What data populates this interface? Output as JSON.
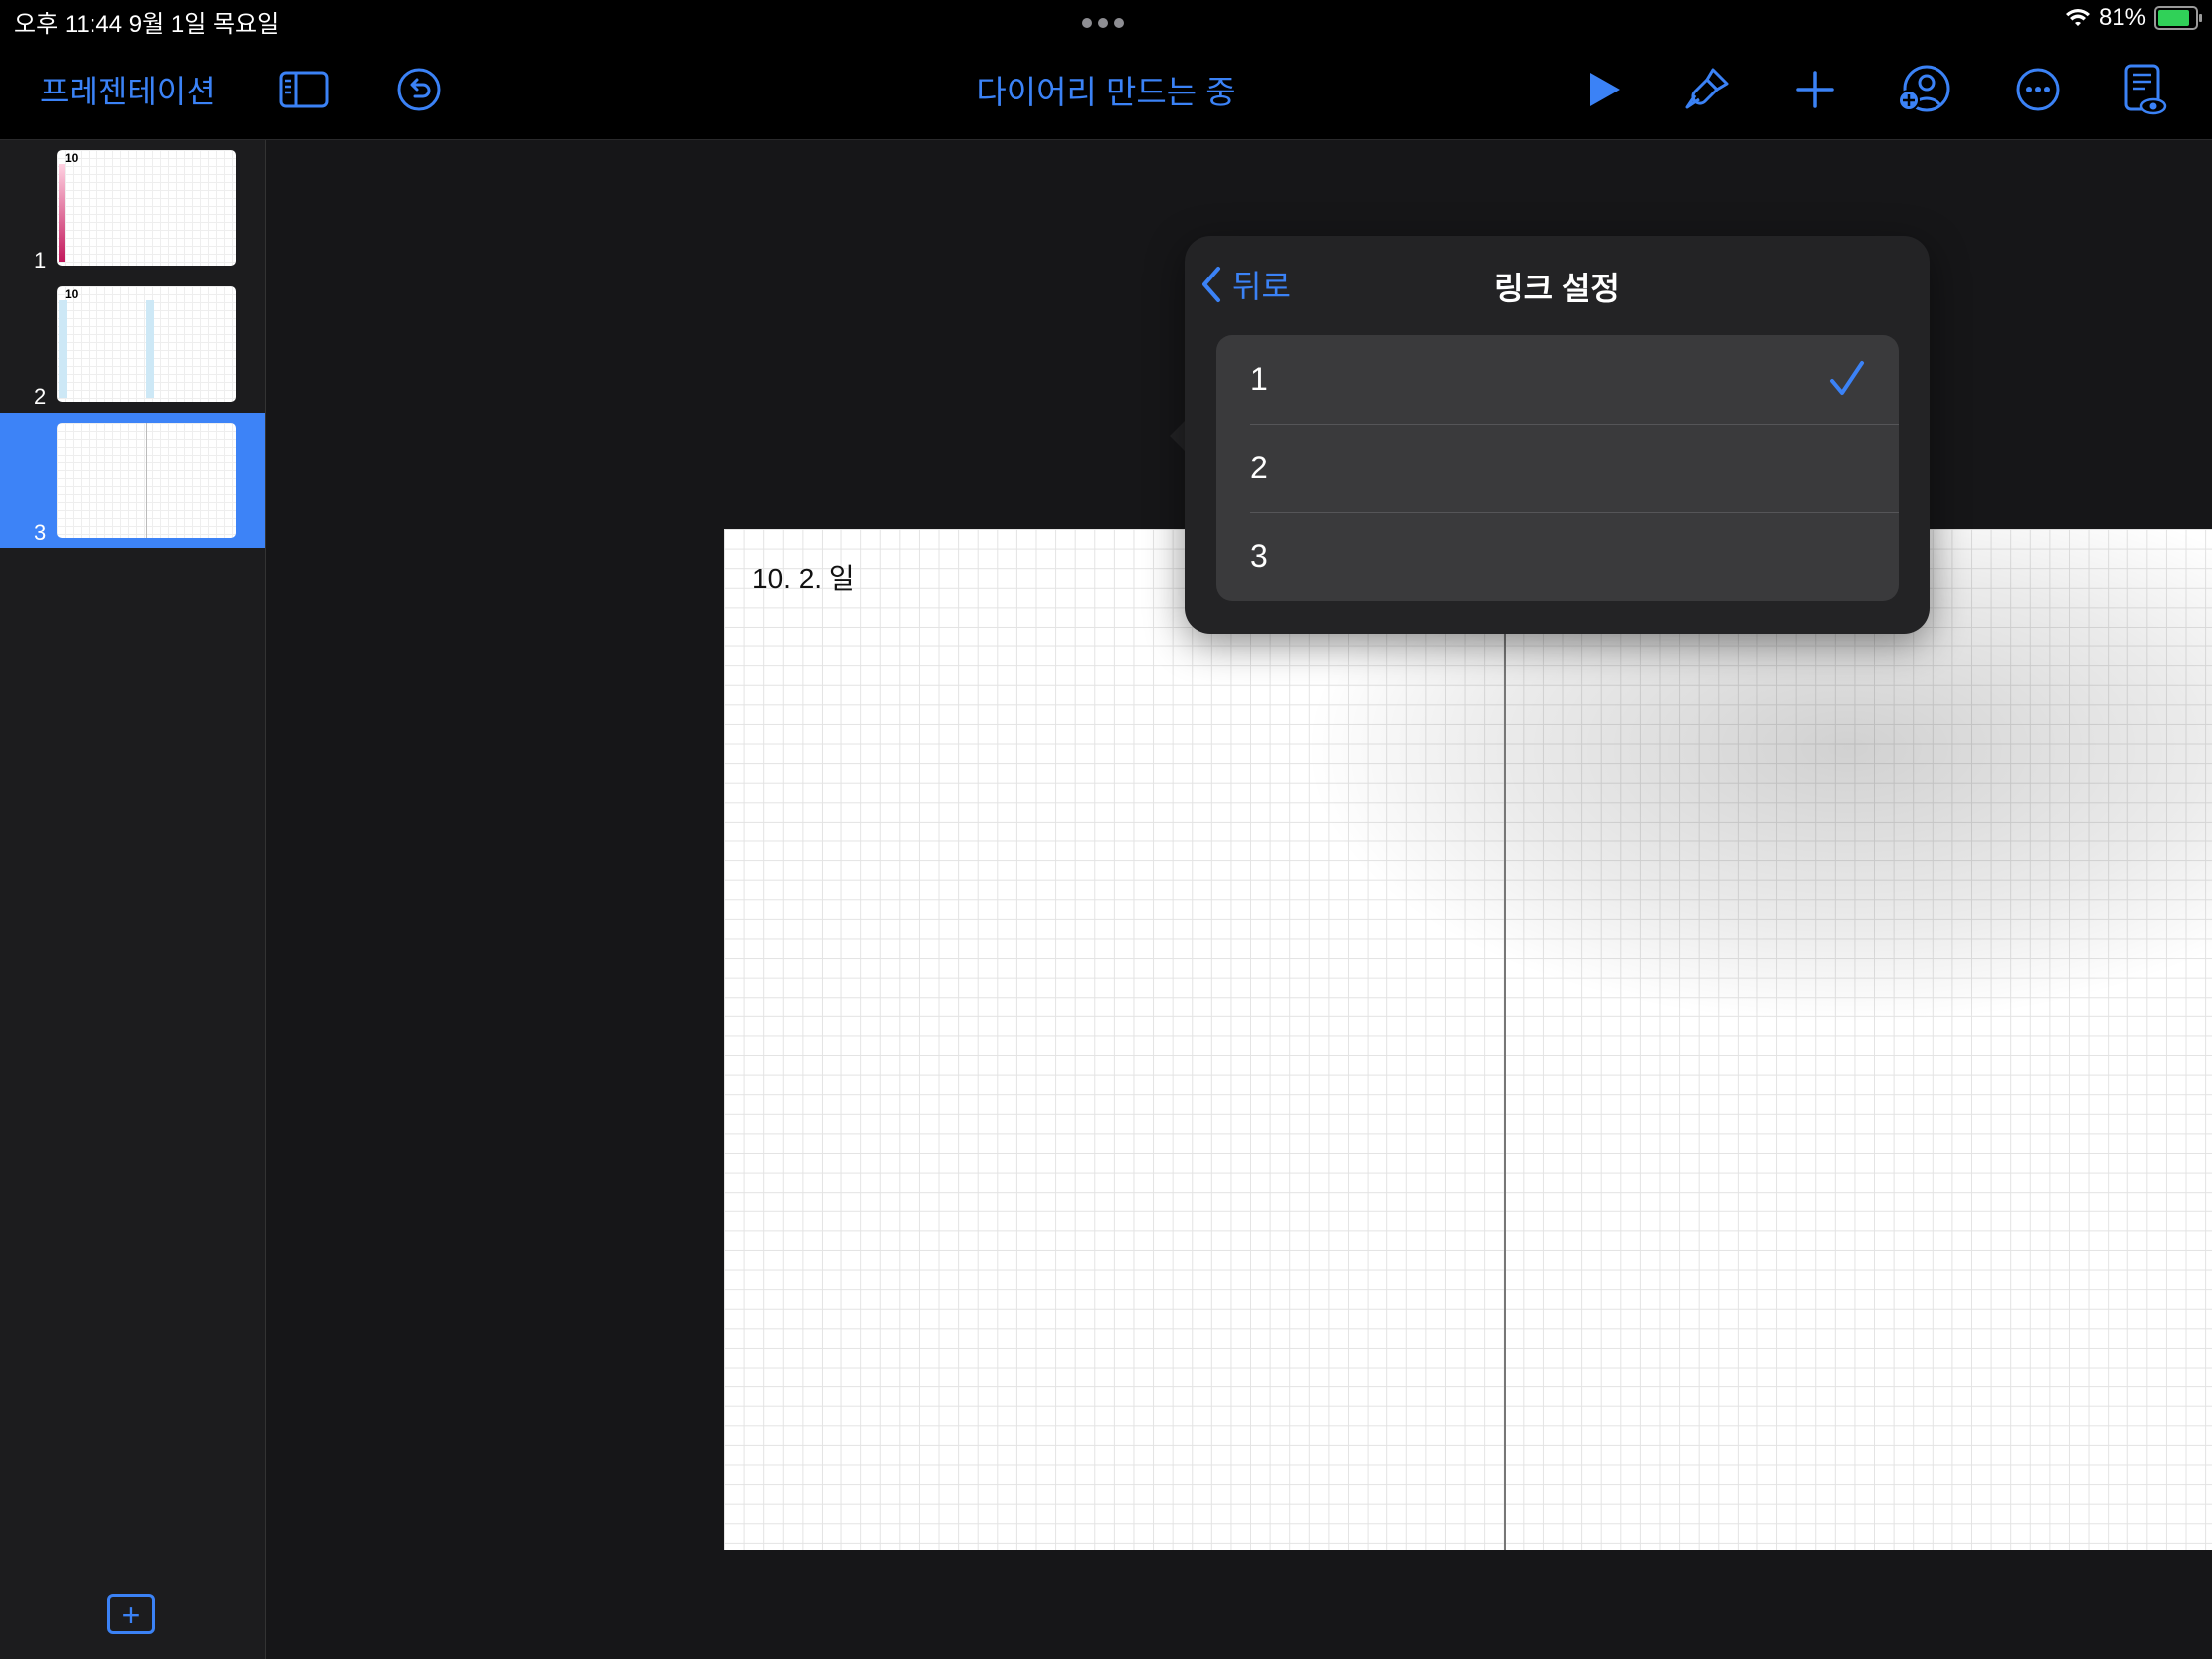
{
  "status_bar": {
    "time_date": "오후 11:44   9월 1일 목요일",
    "battery_percent": "81%",
    "battery_level": 0.81,
    "wifi_icon": "wifi-icon",
    "battery_icon": "battery-charging-icon"
  },
  "toolbar": {
    "presentation_label": "프레젠테이션",
    "document_title": "다이어리 만드는 중",
    "icons": [
      "sidebar-toggle-icon",
      "undo-icon",
      "play-icon",
      "format-brush-icon",
      "plus-icon",
      "collaborate-icon",
      "more-icon",
      "presenter-notes-icon"
    ],
    "accent_color": "#3b82f6"
  },
  "sidebar": {
    "slides": [
      {
        "number": "1",
        "header": "10"
      },
      {
        "number": "2",
        "header": "10"
      },
      {
        "number": "3",
        "header": ""
      }
    ],
    "selected_slide": "3",
    "selected_color": "#3d83f7"
  },
  "slide": {
    "date_text": "10. 2. 일"
  },
  "popover": {
    "back_label": "뒤로",
    "title": "링크 설정",
    "options": [
      "1",
      "2",
      "3"
    ],
    "selected_option": "1"
  }
}
